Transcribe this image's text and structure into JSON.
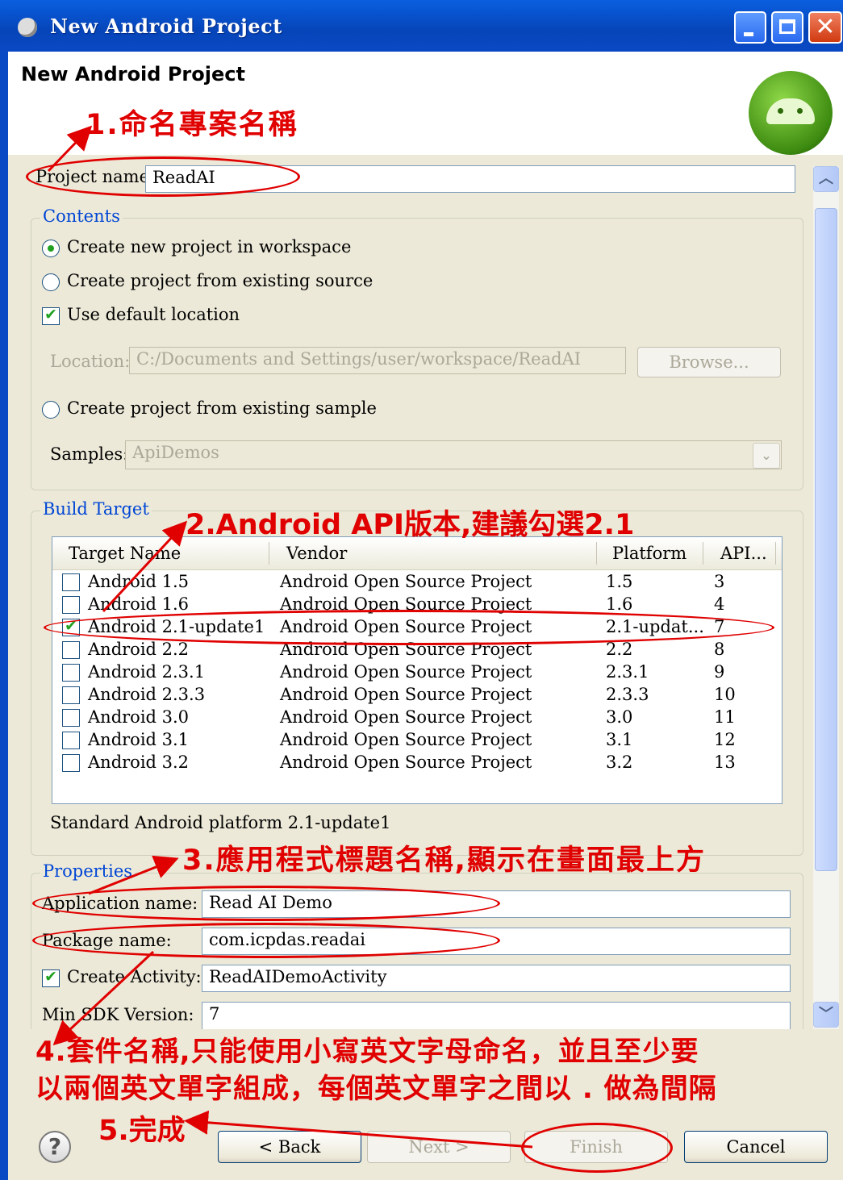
{
  "window": {
    "title": "New Android Project"
  },
  "header": {
    "title": "New Android Project"
  },
  "project": {
    "name_label": "Project name:",
    "name_value": "ReadAI"
  },
  "contents": {
    "label": "Contents",
    "radio_new": "Create new project in workspace",
    "radio_existing": "Create project from existing source",
    "use_default": "Use default location",
    "location_label": "Location:",
    "location_value": "C:/Documents and Settings/user/workspace/ReadAI",
    "browse": "Browse...",
    "radio_sample": "Create project from existing sample",
    "samples_label": "Samples:",
    "samples_value": "ApiDemos"
  },
  "build_target": {
    "label": "Build Target",
    "columns": [
      "Target Name",
      "Vendor",
      "Platform",
      "API..."
    ],
    "rows": [
      {
        "name": "Android 1.5",
        "vendor": "Android Open Source Project",
        "platform": "1.5",
        "api": "3",
        "checked": false
      },
      {
        "name": "Android 1.6",
        "vendor": "Android Open Source Project",
        "platform": "1.6",
        "api": "4",
        "checked": false
      },
      {
        "name": "Android 2.1-update1",
        "vendor": "Android Open Source Project",
        "platform": "2.1-updat...",
        "api": "7",
        "checked": true
      },
      {
        "name": "Android 2.2",
        "vendor": "Android Open Source Project",
        "platform": "2.2",
        "api": "8",
        "checked": false
      },
      {
        "name": "Android 2.3.1",
        "vendor": "Android Open Source Project",
        "platform": "2.3.1",
        "api": "9",
        "checked": false
      },
      {
        "name": "Android 2.3.3",
        "vendor": "Android Open Source Project",
        "platform": "2.3.3",
        "api": "10",
        "checked": false
      },
      {
        "name": "Android 3.0",
        "vendor": "Android Open Source Project",
        "platform": "3.0",
        "api": "11",
        "checked": false
      },
      {
        "name": "Android 3.1",
        "vendor": "Android Open Source Project",
        "platform": "3.1",
        "api": "12",
        "checked": false
      },
      {
        "name": "Android 3.2",
        "vendor": "Android Open Source Project",
        "platform": "3.2",
        "api": "13",
        "checked": false
      }
    ],
    "description": "Standard Android platform 2.1-update1"
  },
  "properties": {
    "label": "Properties",
    "app_name_label": "Application name:",
    "app_name_value": "Read AI Demo",
    "package_label": "Package name:",
    "package_value": "com.icpdas.readai",
    "create_activity_label": "Create Activity:",
    "create_activity_value": "ReadAIDemoActivity",
    "min_sdk_label": "Min SDK Version:",
    "min_sdk_value": "7"
  },
  "buttons": {
    "help": "?",
    "back": "< Back",
    "next": "Next >",
    "finish": "Finish",
    "cancel": "Cancel"
  },
  "annotations": {
    "a1": "1.命名專案名稱",
    "a2": "2.Android API版本,建議勾選2.1",
    "a3": "3.應用程式標題名稱,顯示在畫面最上方",
    "a4_line1": "4.套件名稱,只能使用小寫英文字母命名，並且至少要",
    "a4_line2": "以兩個英文單字組成，每個英文單字之間以 . 做為間隔",
    "a5": "5.完成"
  },
  "colors": {
    "annotation": "#e00000",
    "titlebar": "#0a5fe0",
    "group_label": "#0046d5"
  }
}
